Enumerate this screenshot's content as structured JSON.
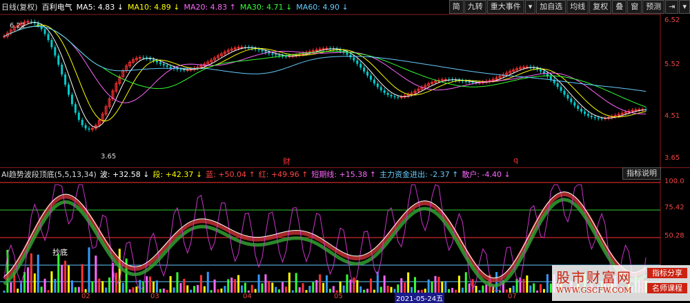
{
  "header": {
    "period": "日线(复权)",
    "stock": "百利电气",
    "ma": [
      {
        "label": "MA5: 4.83",
        "arrow": "↓",
        "color": "#ffffff"
      },
      {
        "label": "MA10: 4.89",
        "arrow": "↓",
        "color": "#ffff00"
      },
      {
        "label": "MA20: 4.83",
        "arrow": "↑",
        "color": "#ff66ff"
      },
      {
        "label": "MA30: 4.71",
        "arrow": "↓",
        "color": "#33ff33"
      },
      {
        "label": "MA60: 4.90",
        "arrow": "↓",
        "color": "#66ccff"
      }
    ]
  },
  "toolbar": [
    "简",
    "九转",
    "重大事件",
    "▾",
    "加自选",
    "均线",
    "复权",
    "叠",
    "窗",
    "预测",
    "⇥",
    "▾"
  ],
  "price_axis": [
    "6.52",
    "5.52",
    "4.51",
    "3.65"
  ],
  "price_labels": {
    "high": "6.22",
    "low": "3.65",
    "cai": "财",
    "q": "q"
  },
  "indicator": {
    "name": "AI趋势波段顶底(5,5,13,34)",
    "items": [
      {
        "label": "波: +32.58",
        "arrow": "↓",
        "color": "#ffffff"
      },
      {
        "label": "段: +42.37",
        "arrow": "↓",
        "color": "#ffff00"
      },
      {
        "label": "蓝: +50.04",
        "arrow": "↑",
        "color": "#ff4444"
      },
      {
        "label": "红: +49.96",
        "arrow": "↑",
        "color": "#ff4444"
      },
      {
        "label": "短期线: +15.38",
        "arrow": "↑",
        "color": "#ff66ff"
      },
      {
        "label": "主力资金进出: -2.37",
        "arrow": "↑",
        "color": "#66ccff"
      },
      {
        "label": "散户: -4.40",
        "arrow": "↓",
        "color": "#ff66ff"
      }
    ],
    "button": "指标说明",
    "axis": [
      "100.0",
      "75.42",
      "50.28"
    ],
    "chao_label": "抄底"
  },
  "date_axis": [
    "02",
    "03",
    "04",
    "05",
    "2021-05-24五",
    "07"
  ],
  "watermark": {
    "title": "股市财富网",
    "url": "WWW.GSCFW.COM",
    "badge1": "指标分享",
    "badge2": "名师课程"
  },
  "colors": {
    "up": "#ff3333",
    "down": "#00cccc",
    "bg": "#000000"
  }
}
